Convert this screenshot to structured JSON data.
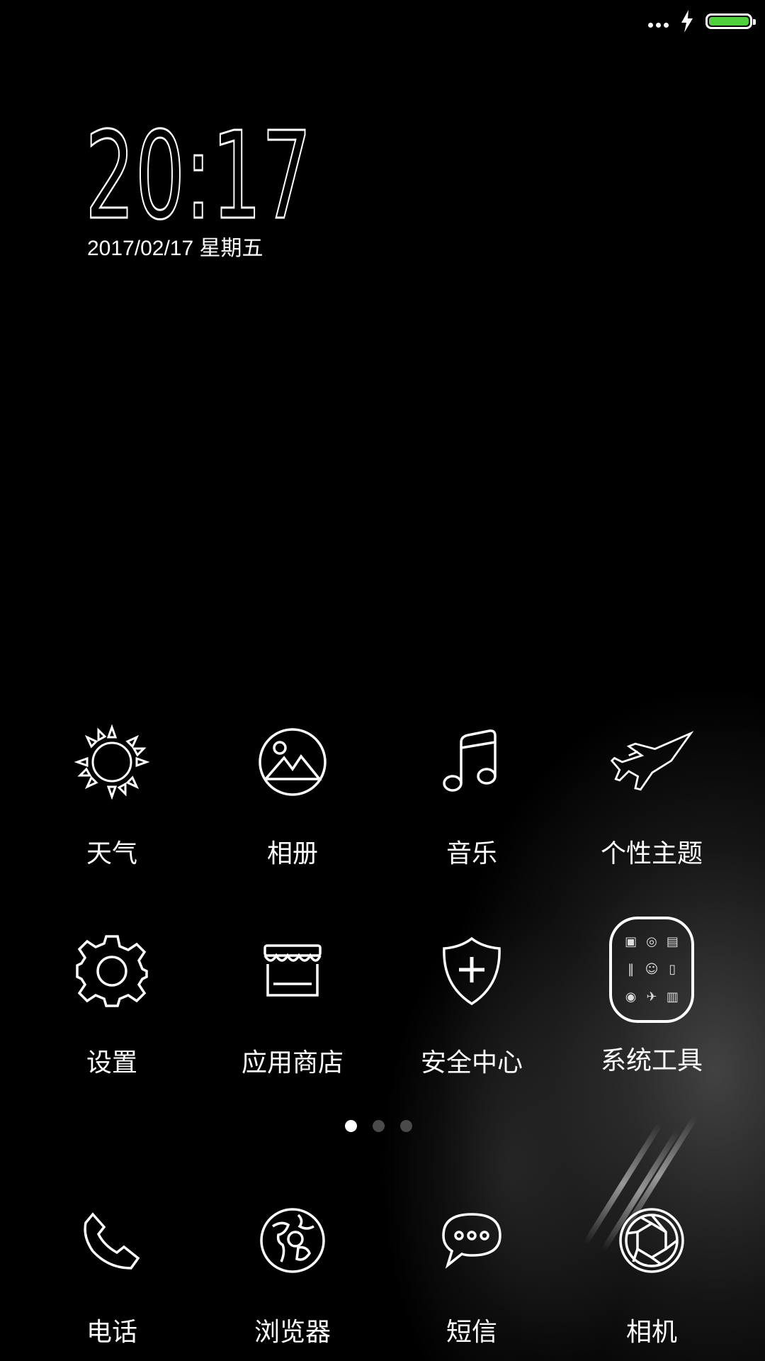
{
  "status_bar": {
    "battery_color": "#4ed13a",
    "icons": [
      "more-dots-icon",
      "charging-bolt-icon",
      "battery-icon"
    ]
  },
  "clock": {
    "time": "20:17",
    "date": "2017/02/17 星期五"
  },
  "apps_row1": [
    {
      "label": "天气",
      "icon": "sun-icon"
    },
    {
      "label": "相册",
      "icon": "gallery-icon"
    },
    {
      "label": "音乐",
      "icon": "music-note-icon"
    },
    {
      "label": "个性主题",
      "icon": "jet-plane-icon"
    }
  ],
  "apps_row2": [
    {
      "label": "设置",
      "icon": "gear-icon"
    },
    {
      "label": "应用商店",
      "icon": "store-icon"
    },
    {
      "label": "安全中心",
      "icon": "shield-plus-icon"
    },
    {
      "label": "系统工具",
      "icon": "folder-icon"
    }
  ],
  "pager": {
    "pages": 3,
    "current": 1
  },
  "dock": [
    {
      "label": "电话",
      "icon": "phone-icon"
    },
    {
      "label": "浏览器",
      "icon": "globe-icon"
    },
    {
      "label": "短信",
      "icon": "message-bubble-icon"
    },
    {
      "label": "相机",
      "icon": "camera-aperture-icon"
    }
  ]
}
